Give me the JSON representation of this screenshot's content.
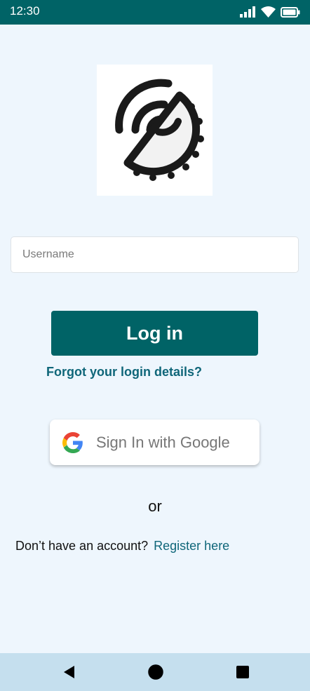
{
  "status_bar": {
    "time": "12:30",
    "icons": [
      "signal-icon",
      "wifi-icon",
      "battery-icon"
    ]
  },
  "logo": {
    "icon": "logo-icon"
  },
  "username": {
    "placeholder": "Username",
    "value": ""
  },
  "login": {
    "label": "Log in"
  },
  "forgot": {
    "label": "Forgot your login details?"
  },
  "google": {
    "label": "Sign In with Google",
    "icon": "google-icon"
  },
  "divider": {
    "text": "or"
  },
  "signup": {
    "prompt": "Don’t have an account?",
    "link_label": "Register here"
  },
  "nav": {
    "icons": [
      "back-icon",
      "home-icon",
      "recents-icon"
    ]
  },
  "colors": {
    "primary": "#006366",
    "link": "#0f6679",
    "background": "#eef6fd",
    "nav_bar": "#c5dfee"
  }
}
